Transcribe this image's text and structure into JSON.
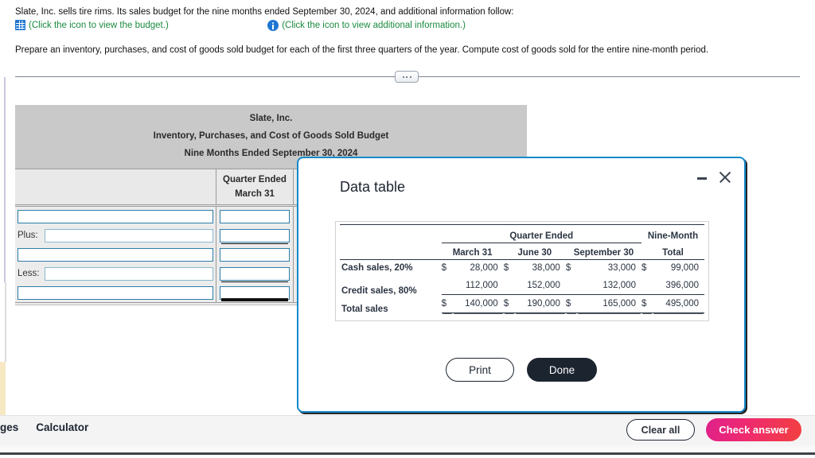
{
  "problem": {
    "line1": "Slate, Inc. sells tire rims. Its sales budget for the nine months ended September 30, 2024, and additional information follow:",
    "link_budget": "(Click the icon to view the budget.)",
    "link_info": "(Click the icon to view additional information.)",
    "line2": "Prepare an inventory, purchases, and cost of goods sold budget for each of the first three quarters of the year. Compute cost of goods sold for the entire nine-month period."
  },
  "worksheet": {
    "title1": "Slate, Inc.",
    "title2": "Inventory, Purchases, and Cost of Goods Sold Budget",
    "title3": "Nine Months Ended September 30, 2024",
    "col_head_line1": "Quarter Ended",
    "col_head_line2": "March 31",
    "rows": [
      {
        "label": "",
        "value": ""
      },
      {
        "label": "Plus:",
        "value": ""
      },
      {
        "label": "",
        "value": ""
      },
      {
        "label": "Less:",
        "value": ""
      },
      {
        "label": "",
        "value": ""
      }
    ]
  },
  "modal": {
    "title": "Data table",
    "minimize_label": "Minimize",
    "close_label": "Close",
    "print_label": "Print",
    "done_label": "Done"
  },
  "chart_data": {
    "type": "table",
    "title": "Data table",
    "group_header": "Quarter Ended",
    "total_header_line1": "Nine-Month",
    "total_header_line2": "Total",
    "categories": [
      "March 31",
      "June 30",
      "September 30",
      "Total"
    ],
    "rows": [
      {
        "label": "Cash sales, 20%",
        "currency": [
          "$",
          "$",
          "$",
          "$"
        ],
        "values": [
          "28,000",
          "38,000",
          "33,000",
          "99,000"
        ],
        "numeric": [
          28000,
          38000,
          33000,
          99000
        ]
      },
      {
        "label": "Credit sales, 80%",
        "currency": [
          "",
          "",
          "",
          ""
        ],
        "values": [
          "112,000",
          "152,000",
          "132,000",
          "396,000"
        ],
        "numeric": [
          112000,
          152000,
          132000,
          396000
        ]
      },
      {
        "label": "Total sales",
        "currency": [
          "$",
          "$",
          "$",
          "$"
        ],
        "values": [
          "140,000",
          "190,000",
          "165,000",
          "495,000"
        ],
        "numeric": [
          140000,
          190000,
          165000,
          495000
        ]
      }
    ]
  },
  "bottom_bar": {
    "item_pages": "ges",
    "item_calculator": "Calculator",
    "clear_all": "Clear all",
    "check_answer": "Check answer"
  },
  "colors": {
    "accent_blue": "#1489ca",
    "link_green": "#1a8a3f",
    "icon_blue": "#1f76d2",
    "dark": "#1c2430",
    "check_gradient_start": "#e0218a",
    "check_gradient_end": "#f2403f"
  }
}
